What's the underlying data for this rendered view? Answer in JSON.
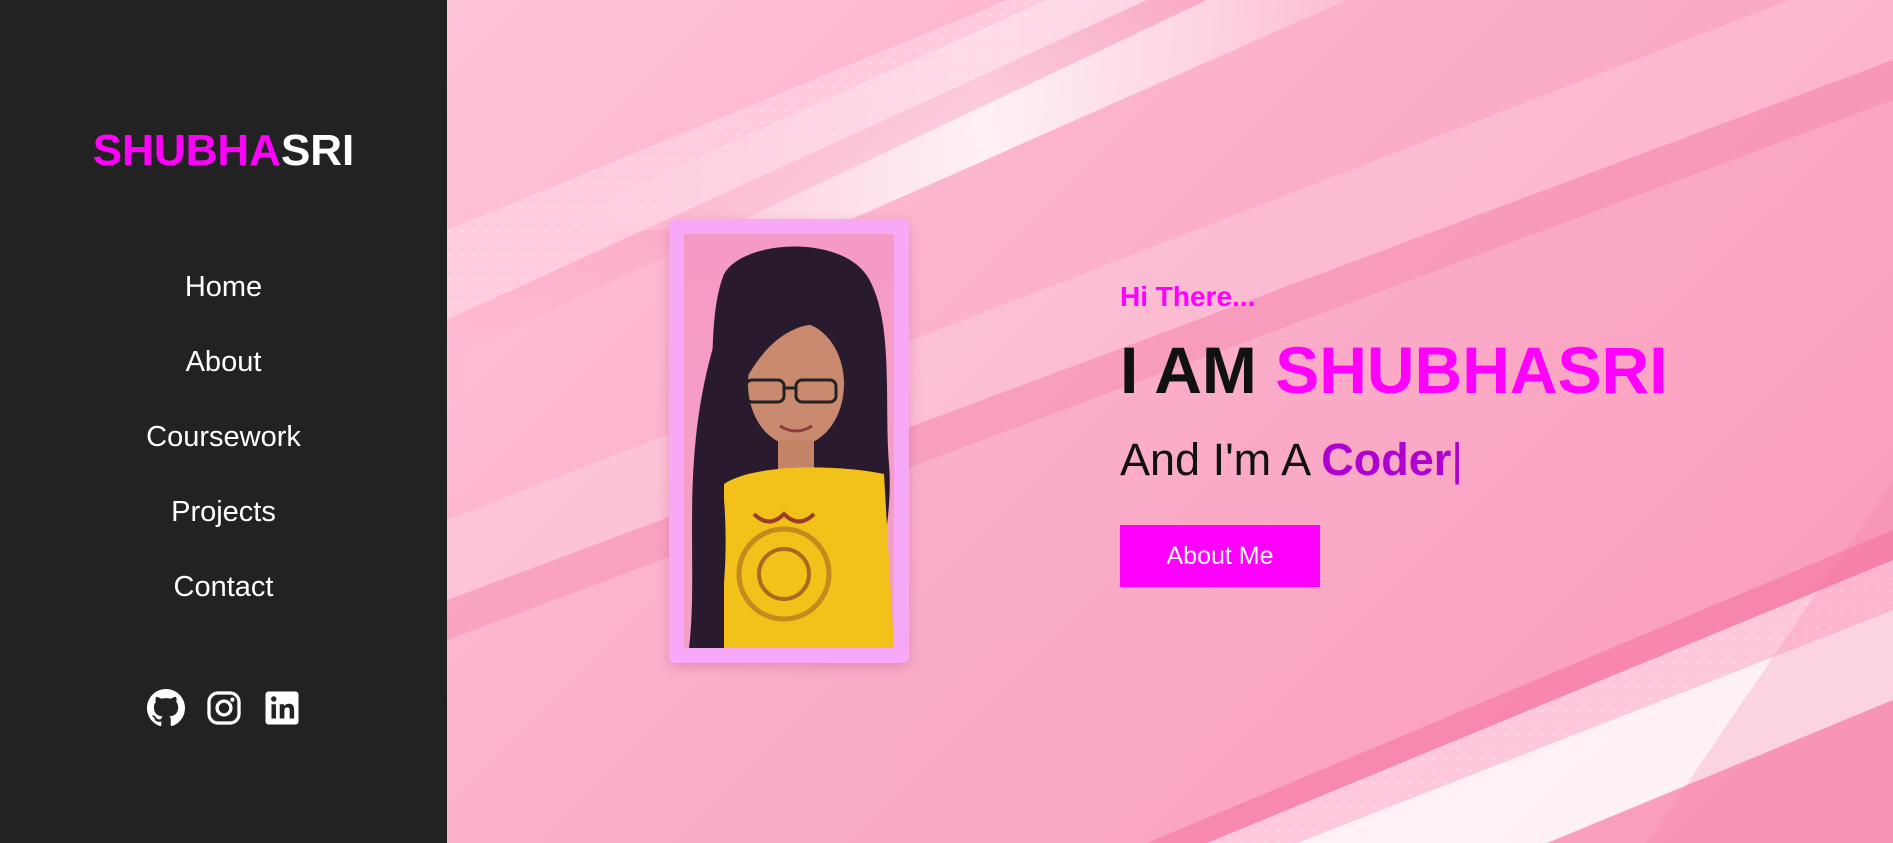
{
  "brand": {
    "part1": "SHUBHA",
    "part2": "SRI"
  },
  "nav": [
    {
      "label": "Home"
    },
    {
      "label": "About"
    },
    {
      "label": "Coursework"
    },
    {
      "label": "Projects"
    },
    {
      "label": "Contact"
    }
  ],
  "socials": [
    {
      "icon": "github-icon"
    },
    {
      "icon": "instagram-icon"
    },
    {
      "icon": "linkedin-icon"
    }
  ],
  "hero": {
    "greeting": "Hi There...",
    "headline_prefix": "I AM ",
    "headline_name": "SHUBHASRI",
    "subline_prefix": "And I'm A ",
    "subline_role": "Coder",
    "cursor": "|",
    "button_label": "About Me"
  },
  "colors": {
    "accent": "#ff00ff",
    "role": "#b000d0",
    "sidebar_bg": "#222222",
    "frame": "#f7a8f7"
  }
}
